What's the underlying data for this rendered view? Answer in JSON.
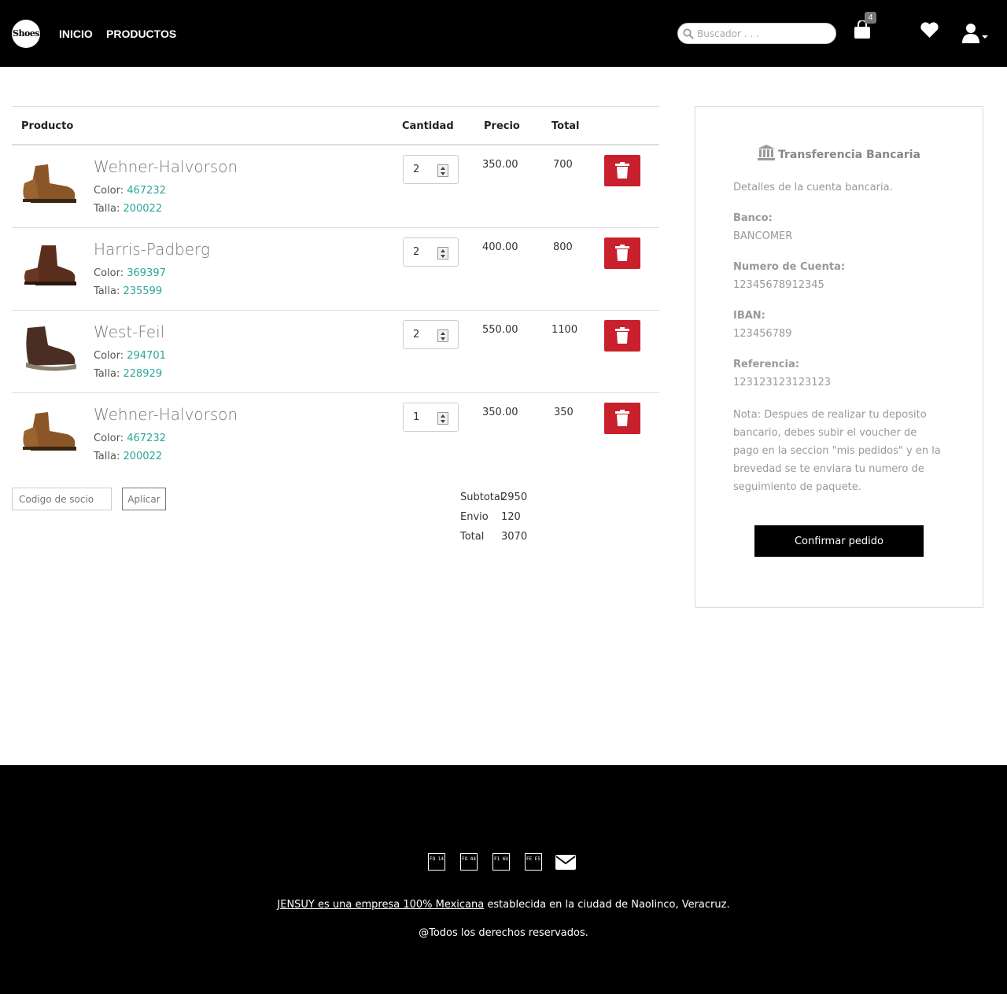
{
  "header": {
    "logo_text": "Shoes",
    "nav": [
      "INICIO",
      "PRODUCTOS"
    ],
    "search_placeholder": "Buscador . . .",
    "cart_count": "4"
  },
  "table": {
    "headers": {
      "producto": "Producto",
      "cantidad": "Cantidad",
      "precio": "Precio",
      "total": "Total"
    },
    "color_label": "Color:",
    "talla_label": "Talla:",
    "items": [
      {
        "name": "Wehner-Halvorson",
        "color": "467232",
        "talla": "200022",
        "qty": "2",
        "price": "350.00",
        "total": "700"
      },
      {
        "name": "Harris-Padberg",
        "color": "369397",
        "talla": "235599",
        "qty": "2",
        "price": "400.00",
        "total": "800"
      },
      {
        "name": "West-Feil",
        "color": "294701",
        "talla": "228929",
        "qty": "2",
        "price": "550.00",
        "total": "1100"
      },
      {
        "name": "Wehner-Halvorson",
        "color": "467232",
        "talla": "200022",
        "qty": "1",
        "price": "350.00",
        "total": "350"
      }
    ]
  },
  "coupon": {
    "placeholder": "Codigo de socio",
    "button": "Aplicar"
  },
  "summary": {
    "subtotal_label": "Subtotal",
    "subtotal": "2950",
    "envio_label": "Envio",
    "envio": "120",
    "total_label": "Total",
    "total": "3070"
  },
  "payment": {
    "title": "Transferencia Bancaria",
    "details": "Detalles de la cuenta bancaria.",
    "banco_label": "Banco:",
    "banco": "BANCOMER",
    "cuenta_label": "Numero de Cuenta:",
    "cuenta": "12345678912345",
    "iban_label": "IBAN:",
    "iban": "123456789",
    "referencia_label": "Referencia:",
    "referencia": "123123123123123",
    "note": "Nota: Despues de realizar tu deposito bancario, debes subir el voucher de pago en la seccion \"mis pedidos\" y en la brevedad se te enviara tu numero de seguimiento de paquete.",
    "confirm": "Confirmar pedido"
  },
  "footer": {
    "social": [
      "FO 14",
      "FO 44",
      "F1 6U",
      "FE E5"
    ],
    "company_link": "JENSUY es una empresa 100% Mexicana",
    "company_rest": " establecida en la ciudad de Naolinco, Veracruz.",
    "rights": "@Todos los derechos reservados."
  },
  "colors": {
    "accent": "#2aa59a",
    "delete": "#c8202c",
    "header_bg": "#000000"
  }
}
